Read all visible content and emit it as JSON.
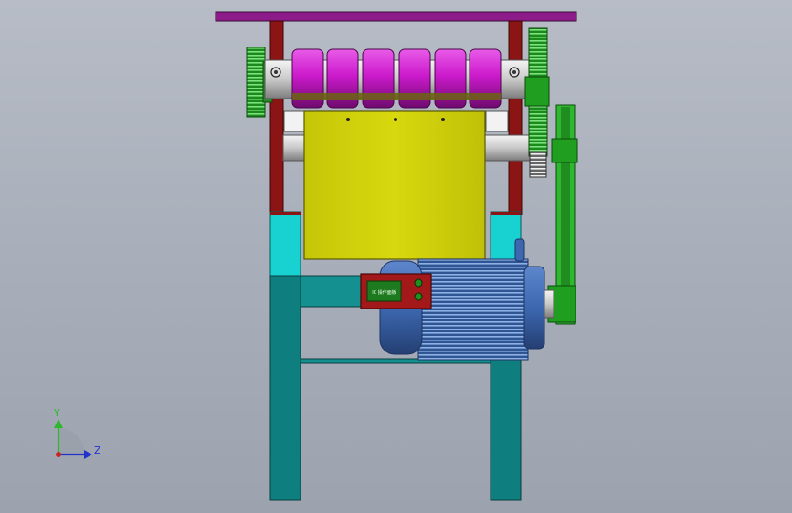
{
  "viewport": {
    "background_top": "#b7bcc6",
    "background_bottom": "#9ca2ae"
  },
  "model": {
    "panel_screen_text": "IC 操作面板",
    "colors": {
      "top_bar": "#8e1b8a",
      "frame_upright": "#8b1414",
      "rollers": "#cc1acc",
      "roller_shadow": "#7a0f7a",
      "hopper": "#d2d20a",
      "leg_top": "#18d2d2",
      "leg": "#0f7e7e",
      "gear": "#1f9e1f",
      "belt": "#2fb82f",
      "motor": "#3d68b0",
      "control_box": "#a31818",
      "screen": "#1e7a1e"
    }
  },
  "triad": {
    "y_label": "Y",
    "z_label": "Z",
    "colors": {
      "y": "#2db82d",
      "z": "#2233cc",
      "x": "#cc2222"
    }
  }
}
